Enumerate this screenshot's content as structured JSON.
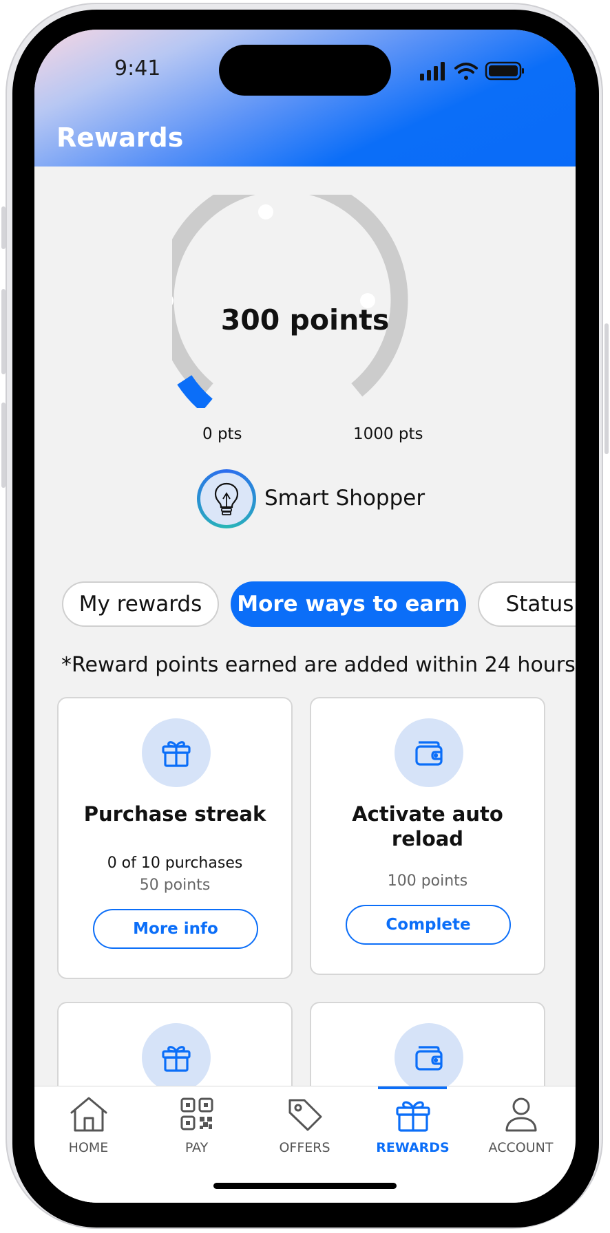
{
  "status_bar": {
    "time": "9:41"
  },
  "header": {
    "title": "Rewards"
  },
  "points_gauge": {
    "points_label": "300 points",
    "min_label": "0 pts",
    "max_label": "1000 pts",
    "current_points": 300,
    "max_points": 1000,
    "colors": {
      "filled": "#0b6ef8",
      "track": "#cccccc"
    }
  },
  "status_badge": {
    "name": "Smart Shopper",
    "icon": "lightbulb-icon"
  },
  "tabs": [
    {
      "label": "My rewards",
      "active": false
    },
    {
      "label": "More ways to earn",
      "active": true
    },
    {
      "label": "Status",
      "active": false
    }
  ],
  "note": "*Reward points earned are added within 24 hours",
  "cards": [
    {
      "icon": "gift-icon",
      "title": "Purchase streak",
      "progress": "0 of 10 purchases",
      "points": "50 points",
      "button": "More info"
    },
    {
      "icon": "wallet-icon",
      "title_line1": "Activate auto",
      "title_line2": "reload",
      "points": "100 points",
      "button": "Complete"
    },
    {
      "icon": "gift-icon"
    },
    {
      "icon": "wallet-icon"
    }
  ],
  "nav": [
    {
      "label": "HOME",
      "icon": "home-icon",
      "active": false
    },
    {
      "label": "PAY",
      "icon": "qr-code-icon",
      "active": false
    },
    {
      "label": "OFFERS",
      "icon": "tag-icon",
      "active": false
    },
    {
      "label": "REWARDS",
      "icon": "gift-icon",
      "active": true
    },
    {
      "label": "ACCOUNT",
      "icon": "person-icon",
      "active": false
    }
  ],
  "accent_color": "#0b6ef8"
}
